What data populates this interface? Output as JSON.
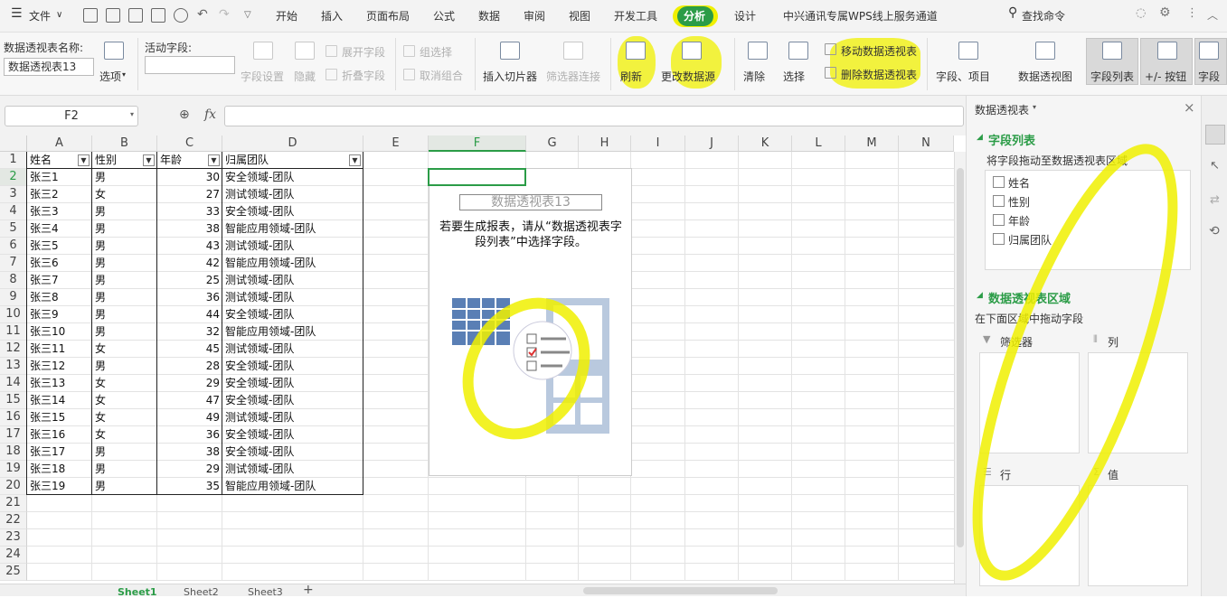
{
  "menubar": {
    "file": "文件",
    "tabs": [
      "开始",
      "插入",
      "页面布局",
      "公式",
      "数据",
      "审阅",
      "视图",
      "开发工具",
      "分析",
      "设计",
      "中兴通讯专属WPS线上服务通道"
    ],
    "search": "查找命令"
  },
  "ribbon": {
    "pivot_name_label": "数据透视表名称:",
    "pivot_name": "数据透视表13",
    "options": "选项",
    "active_field_label": "活动字段:",
    "field_settings": "字段设置",
    "hide": "隐藏",
    "expand_field": "展开字段",
    "collapse_field": "折叠字段",
    "group_selection": "组选择",
    "ungroup": "取消组合",
    "insert_slicer": "插入切片器",
    "filter_connection": "筛选器连接",
    "refresh": "刷新",
    "change_source": "更改数据源",
    "move_pivot": "移动数据透视表",
    "delete_pivot": "删除数据透视表",
    "clear": "清除",
    "select": "选择",
    "fields_items": "字段、项目",
    "pivot_chart": "数据透视图",
    "field_list": "字段列表",
    "plus_minus": "+/- 按钮",
    "field_headers": "字段"
  },
  "formula": {
    "name_box": "F2",
    "fx": "fx"
  },
  "columns": [
    "A",
    "B",
    "C",
    "D",
    "E",
    "F",
    "G",
    "H",
    "I",
    "J",
    "K",
    "L",
    "M",
    "N"
  ],
  "rows": [
    "1",
    "2",
    "3",
    "4",
    "5",
    "6",
    "7",
    "8",
    "9",
    "10",
    "11",
    "12",
    "13",
    "14",
    "15",
    "16",
    "17",
    "18",
    "19",
    "20",
    "21",
    "22",
    "23",
    "24",
    "25"
  ],
  "table": {
    "headers": [
      "姓名",
      "性别",
      "年龄",
      "归属团队"
    ],
    "rows": [
      [
        "张三1",
        "男",
        "30",
        "安全领域-团队"
      ],
      [
        "张三2",
        "女",
        "27",
        "测试领域-团队"
      ],
      [
        "张三3",
        "男",
        "33",
        "安全领域-团队"
      ],
      [
        "张三4",
        "男",
        "38",
        "智能应用领域-团队"
      ],
      [
        "张三5",
        "男",
        "43",
        "测试领域-团队"
      ],
      [
        "张三6",
        "男",
        "42",
        "智能应用领域-团队"
      ],
      [
        "张三7",
        "男",
        "25",
        "测试领域-团队"
      ],
      [
        "张三8",
        "男",
        "36",
        "测试领域-团队"
      ],
      [
        "张三9",
        "男",
        "44",
        "安全领域-团队"
      ],
      [
        "张三10",
        "男",
        "32",
        "智能应用领域-团队"
      ],
      [
        "张三11",
        "女",
        "45",
        "测试领域-团队"
      ],
      [
        "张三12",
        "男",
        "28",
        "安全领域-团队"
      ],
      [
        "张三13",
        "女",
        "29",
        "安全领域-团队"
      ],
      [
        "张三14",
        "女",
        "47",
        "安全领域-团队"
      ],
      [
        "张三15",
        "女",
        "49",
        "测试领域-团队"
      ],
      [
        "张三16",
        "女",
        "36",
        "安全领域-团队"
      ],
      [
        "张三17",
        "男",
        "38",
        "安全领域-团队"
      ],
      [
        "张三18",
        "男",
        "29",
        "测试领域-团队"
      ],
      [
        "张三19",
        "男",
        "35",
        "智能应用领域-团队"
      ]
    ]
  },
  "pivot": {
    "title": "数据透视表13",
    "hint": "若要生成报表，请从“数据透视表字段列表”中选择字段。"
  },
  "sheets": [
    "Sheet1",
    "Sheet2",
    "Sheet3"
  ],
  "panel": {
    "title": "数据透视表",
    "field_list_heading": "字段列表",
    "drag_hint": "将字段拖动至数据透视表区域",
    "fields": [
      "姓名",
      "性别",
      "年龄",
      "归属团队"
    ],
    "areas_heading": "数据透视表区域",
    "areas_hint": "在下面区域中拖动字段",
    "filter": "筛选器",
    "columns": "列",
    "rows": "行",
    "values": "值"
  },
  "colors": {
    "accent": "#2b9c47",
    "highlight": "#f0f000"
  }
}
